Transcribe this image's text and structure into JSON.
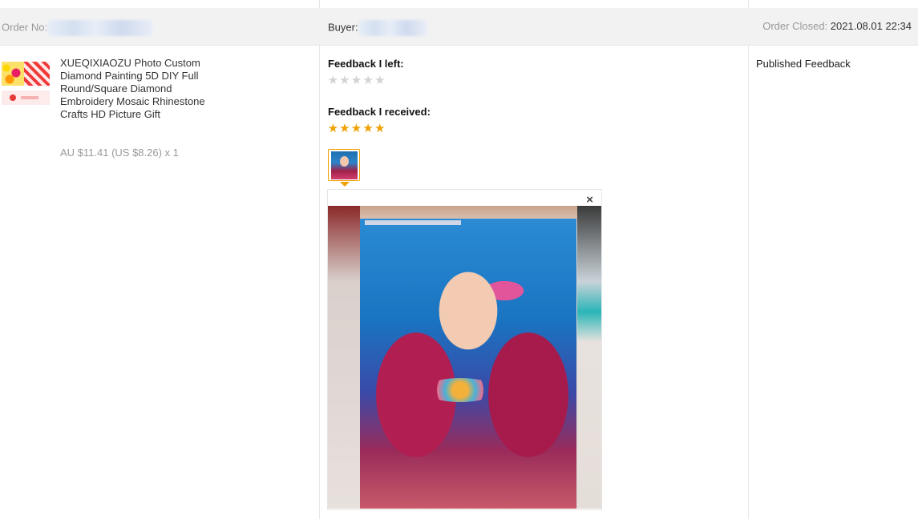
{
  "header": {
    "order_label": "Order No:",
    "buyer_label": "Buyer:",
    "closed_label": "Order Closed:",
    "closed_date": "2021.08.01 22:34"
  },
  "product": {
    "title": "XUEQIXIAOZU Photo Custom Diamond Painting 5D DIY Full Round/Square Diamond Embroidery Mosaic Rhinestone Crafts HD Picture Gift",
    "price": "AU $11.41 (US $8.26) x 1"
  },
  "feedback": {
    "left_label": "Feedback I left:",
    "left_rating": 0,
    "received_label": "Feedback I received:",
    "received_rating": 5,
    "close_icon": "×"
  },
  "status": {
    "text": "Published Feedback"
  },
  "icons": {
    "star": "star-icon",
    "close": "close-icon"
  },
  "colors": {
    "header_bg": "#f2f2f2",
    "star_filled": "#f0a000",
    "star_empty": "#d3d3d3",
    "muted_text": "#999999"
  }
}
